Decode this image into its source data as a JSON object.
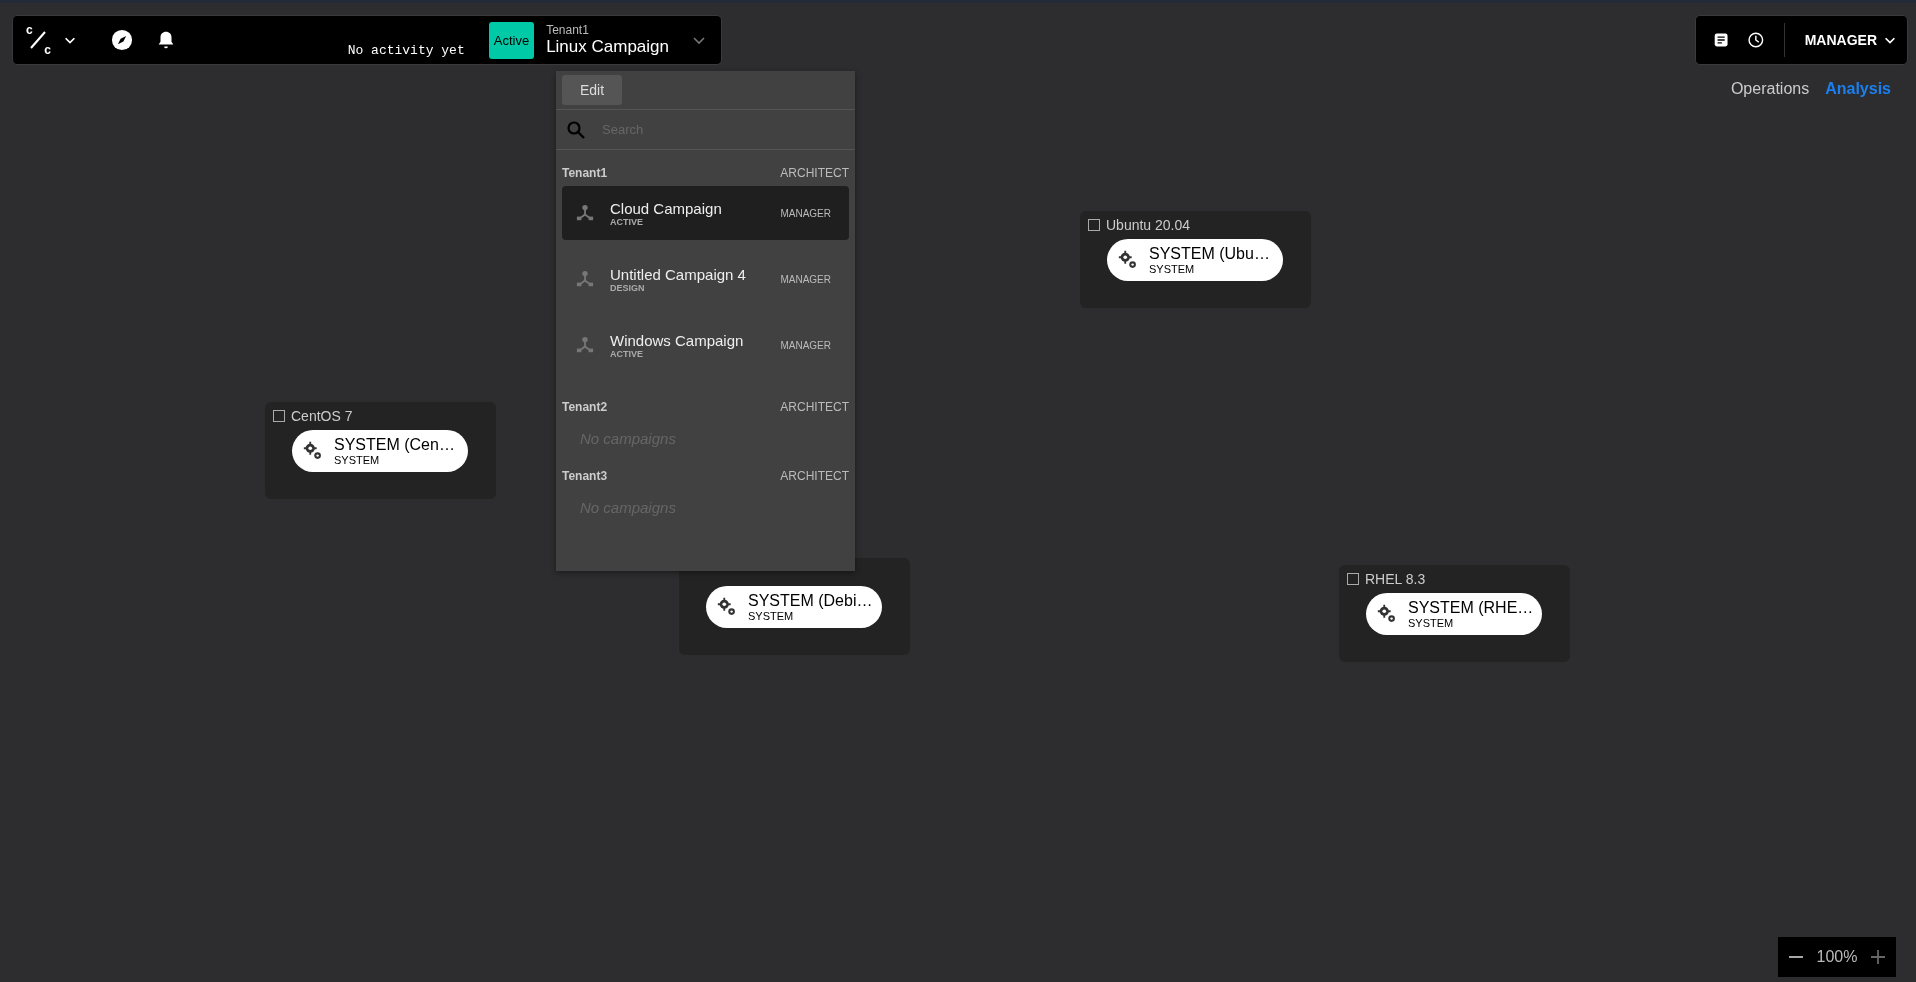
{
  "topbar": {
    "logo_top": "c",
    "logo_bottom": "c",
    "activity": "No activity yet",
    "status_badge": "Active",
    "tenant": "Tenant1",
    "campaign": "Linux Campaign"
  },
  "dropdown": {
    "edit_button": "Edit",
    "search": {
      "placeholder": "Search"
    },
    "tenants": [
      {
        "name": "Tenant1",
        "role": "ARCHITECT",
        "campaigns": [
          {
            "name": "Cloud Campaign",
            "status": "ACTIVE",
            "role": "MANAGER",
            "selected": true
          },
          {
            "name": "Untitled Campaign 4",
            "status": "DESIGN",
            "role": "MANAGER",
            "selected": false
          },
          {
            "name": "Windows Campaign",
            "status": "ACTIVE",
            "role": "MANAGER",
            "selected": false
          }
        ]
      },
      {
        "name": "Tenant2",
        "role": "ARCHITECT",
        "empty": "No campaigns"
      },
      {
        "name": "Tenant3",
        "role": "ARCHITECT",
        "empty": "No campaigns"
      }
    ]
  },
  "user_menu": {
    "role": "MANAGER"
  },
  "view_tabs": [
    {
      "label": "Operations",
      "selected": false
    },
    {
      "label": "Analysis",
      "selected": true
    }
  ],
  "nodes": [
    {
      "title": "CentOS 7",
      "checked": false,
      "service": "SYSTEM (Cen…",
      "type": "SYSTEM"
    },
    {
      "title": "Ubuntu 20.04",
      "checked": false,
      "service": "SYSTEM (Ubu…",
      "type": "SYSTEM"
    },
    {
      "service": "SYSTEM (Debi…",
      "type": "SYSTEM"
    },
    {
      "title": "RHEL 8.3",
      "checked": false,
      "service": "SYSTEM (RHE…",
      "type": "SYSTEM"
    }
  ],
  "zoom": {
    "level_text": "100%"
  }
}
